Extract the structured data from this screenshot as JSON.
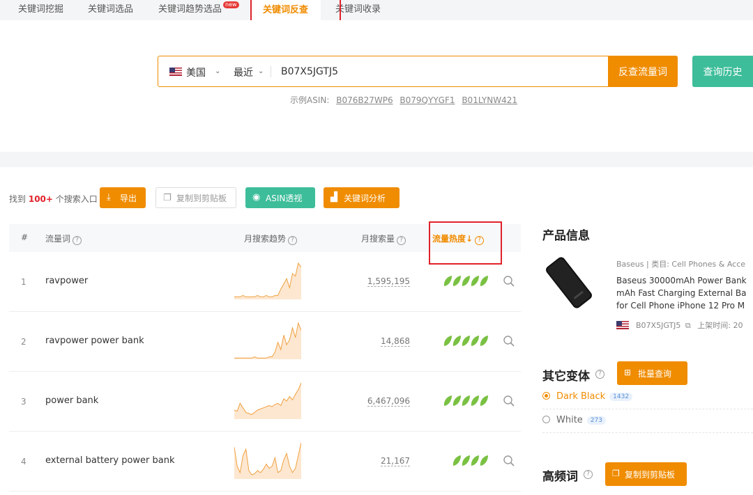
{
  "tabs": [
    {
      "label": "关键词挖掘"
    },
    {
      "label": "关键词选品"
    },
    {
      "label": "关键词趋势选品",
      "badge": "new"
    },
    {
      "label": "关键词反查",
      "active": true
    },
    {
      "label": "关键词收录"
    }
  ],
  "search": {
    "country": "美国",
    "range": "最近",
    "asin_value": "B07X5JGTJ5",
    "reverse_button": "反查流量词",
    "history_button": "查询历史",
    "examples_label": "示例ASIN:",
    "examples": [
      "B076B27WP6",
      "B079QYYGF1",
      "B01LYNW421"
    ]
  },
  "toolbar": {
    "found_prefix": "找到",
    "found_count": "100+",
    "found_suffix": "个搜索入口",
    "export_label": "导出",
    "copy_label": "复制到剪贴板",
    "asin_label": "ASIN透视",
    "kw_analysis_label": "关键词分析"
  },
  "table": {
    "headers": {
      "index": "#",
      "keyword": "流量词",
      "trend": "月搜索趋势",
      "volume": "月搜索量",
      "heat": "流量热度↓"
    },
    "rows": [
      {
        "index": "1",
        "keyword": "ravpower",
        "volume": "1,595,195",
        "heat": 5,
        "trend": [
          2,
          2,
          2,
          3,
          2,
          2,
          2,
          2,
          3,
          2,
          2,
          3,
          2,
          2,
          3,
          3,
          8,
          12,
          16,
          9,
          20,
          18,
          28,
          25
        ]
      },
      {
        "index": "2",
        "keyword": "ravpower power bank",
        "volume": "14,868",
        "heat": 5,
        "trend": [
          1,
          1,
          1,
          1,
          1,
          1,
          1,
          2,
          1,
          1,
          1,
          1,
          2,
          2,
          6,
          14,
          8,
          20,
          12,
          16,
          26,
          18,
          30,
          24
        ]
      },
      {
        "index": "3",
        "keyword": "power bank",
        "volume": "6,467,096",
        "heat": 5,
        "trend": [
          8,
          7,
          14,
          10,
          6,
          5,
          4,
          6,
          8,
          9,
          10,
          11,
          12,
          11,
          13,
          14,
          12,
          18,
          16,
          20,
          17,
          22,
          26,
          32
        ]
      },
      {
        "index": "4",
        "keyword": "external battery power bank",
        "volume": "21,167",
        "heat": 4,
        "trend": [
          30,
          12,
          6,
          22,
          28,
          8,
          4,
          5,
          8,
          6,
          9,
          14,
          10,
          12,
          20,
          6,
          8,
          18,
          24,
          12,
          6,
          10,
          22,
          34
        ]
      }
    ]
  },
  "product": {
    "section_title": "产品信息",
    "brand": "Baseus",
    "category": "类目: Cell Phones & Acce",
    "title_lines": [
      "Baseus 30000mAh Power Bank",
      "mAh Fast Charging External Ba",
      "for Cell Phone iPhone 12 Pro M"
    ],
    "asin": "B07X5JGTJ5",
    "listed_label": "上架时间: 20"
  },
  "variants": {
    "section_title": "其它变体",
    "batch_button": "批量查询",
    "items": [
      {
        "name": "Dark Black",
        "count": "1432",
        "selected": true
      },
      {
        "name": "White",
        "count": "273",
        "selected": false
      }
    ]
  },
  "high_freq": {
    "section_title": "高频词",
    "copy_button": "复制到剪贴板"
  },
  "colors": {
    "accent": "#f08c00",
    "green": "#3dbd9a",
    "annotation": "#e0212a",
    "leaf": "#7ac143"
  }
}
